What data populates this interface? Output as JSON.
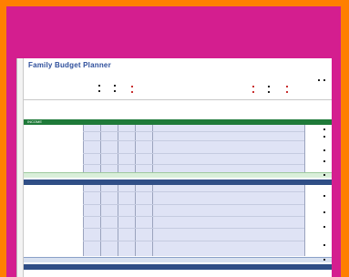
{
  "sheet": {
    "title": "Family Budget Planner",
    "subtitle": "",
    "start_label": "",
    "start_value": "",
    "summary_labels": [
      "",
      "",
      "",
      ""
    ],
    "months": [
      "",
      "",
      "",
      "",
      "",
      "",
      "",
      "",
      "",
      "",
      "",
      ""
    ],
    "year_total_label": "",
    "income": {
      "header": "INCOME",
      "rows": [
        "",
        "",
        "",
        "",
        "",
        "",
        ""
      ],
      "total_label": ""
    },
    "expenses": {
      "header": "",
      "rows": [
        "",
        "",
        "",
        "",
        "",
        "",
        "",
        "",
        "",
        "",
        "",
        "",
        "",
        "",
        "",
        "",
        "",
        ""
      ],
      "total_label": ""
    },
    "section3": {
      "header": "",
      "rows": [
        "",
        "",
        ""
      ]
    }
  },
  "colors": {
    "outer_border": "#ff7f00",
    "background": "#d41e8f",
    "income_header": "#1f7a39",
    "expense_header": "#2f4e86",
    "input_cells": "#dfe3f5",
    "title": "#2d4e9b"
  }
}
